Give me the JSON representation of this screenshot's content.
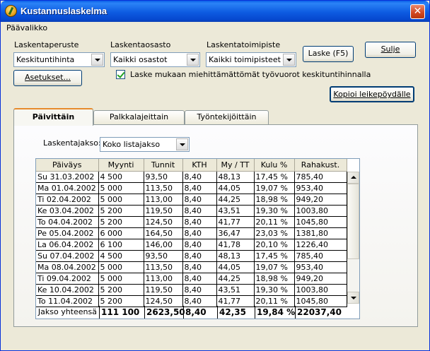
{
  "window": {
    "title": "Kustannuslaskelma",
    "close_glyph": "✕"
  },
  "menu": {
    "items": [
      "Päävalikko"
    ]
  },
  "filters": {
    "laskentaperuste": {
      "label": "Laskentaperuste",
      "value": "Keskituntihinta"
    },
    "laskentaosasto": {
      "label": "Laskentaosasto",
      "value": "Kaikki osastot"
    },
    "laskentatoimipiste": {
      "label": "Laskentatoimipiste",
      "value": "Kaikki toimipisteet"
    }
  },
  "buttons": {
    "laske": "Laske (F5)",
    "sulje": "Sulje",
    "asetukset": "Asetukset...",
    "kopioi": "Kopioi leikepöydälle"
  },
  "checkbox": {
    "label": "Laske mukaan miehittämättömät työvuorot keskituntihinnalla",
    "checked": true
  },
  "tabs": [
    "Päivittäin",
    "Palkkalajeittain",
    "Työntekijöittäin"
  ],
  "period": {
    "label": "Laskentajakso:",
    "value": "Koko listajakso"
  },
  "table": {
    "columns": [
      "Päiväys",
      "Myynti",
      "Tunnit",
      "KTH",
      "My / TT",
      "Kulu %",
      "Rahakust."
    ],
    "rows": [
      [
        "Su 31.03.2002",
        "4 500",
        "93,50",
        "8,40",
        "48,13",
        "17,45 %",
        "785,40"
      ],
      [
        "Ma 01.04.2002",
        "5 000",
        "113,50",
        "8,40",
        "44,05",
        "19,07 %",
        "953,40"
      ],
      [
        "Ti 02.04.2002",
        "5 000",
        "113,00",
        "8,40",
        "44,25",
        "18,98 %",
        "949,20"
      ],
      [
        "Ke 03.04.2002",
        "5 200",
        "119,50",
        "8,40",
        "43,51",
        "19,30 %",
        "1003,80"
      ],
      [
        "To 04.04.2002",
        "5 200",
        "124,50",
        "8,40",
        "41,77",
        "20,11 %",
        "1045,80"
      ],
      [
        "Pe 05.04.2002",
        "6 000",
        "164,50",
        "8,40",
        "36,47",
        "23,03 %",
        "1381,80"
      ],
      [
        "La 06.04.2002",
        "6 100",
        "146,00",
        "8,40",
        "41,78",
        "20,10 %",
        "1226,40"
      ],
      [
        "Su 07.04.2002",
        "4 500",
        "93,50",
        "8,40",
        "48,13",
        "17,45 %",
        "785,40"
      ],
      [
        "Ma 08.04.2002",
        "5 000",
        "113,50",
        "8,40",
        "44,05",
        "19,07 %",
        "953,40"
      ],
      [
        "Ti 09.04.2002",
        "5 000",
        "113,00",
        "8,40",
        "44,25",
        "18,98 %",
        "949,20"
      ],
      [
        "Ke 10.04.2002",
        "5 200",
        "119,50",
        "8,40",
        "43,51",
        "19,30 %",
        "1003,80"
      ],
      [
        "To 11.04.2002",
        "5 200",
        "124,50",
        "8,40",
        "41,77",
        "20,11 %",
        "1045,80"
      ]
    ],
    "totals": {
      "label": "Jakso yhteensä",
      "values": [
        "111 100",
        "2623,50",
        "8,40",
        "42,35",
        "19,84 %",
        "22037,40"
      ]
    }
  }
}
